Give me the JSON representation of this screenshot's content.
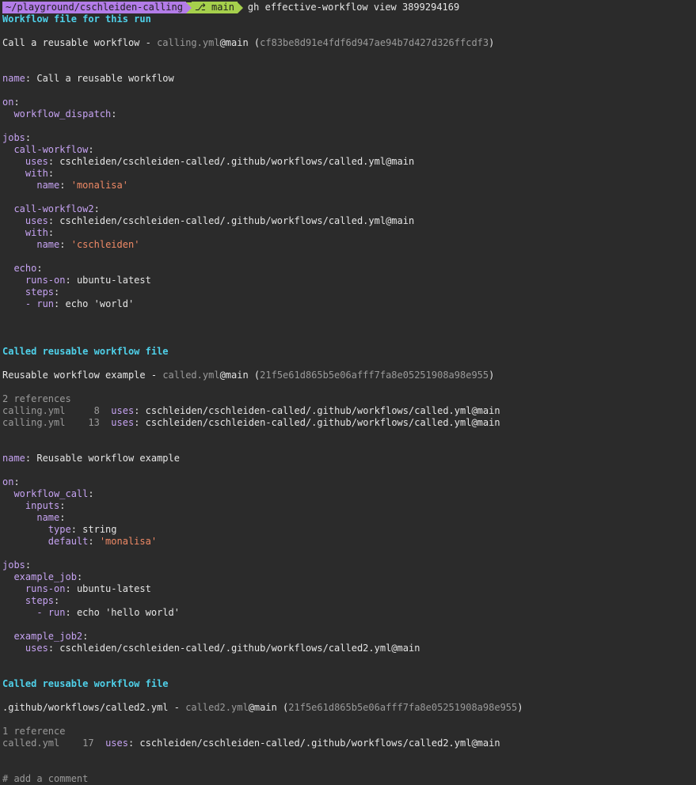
{
  "prompt": {
    "path": "~/playground/cschleiden-calling",
    "branch_icon": "git-branch-icon",
    "branch": " main",
    "command": "gh effective-workflow view 3899294169"
  },
  "colors": {
    "background": "#2b2b2b",
    "header": "#4fd1ea",
    "yaml_key": "#c6a3f2",
    "yaml_string": "#f08a66",
    "dim": "#9a9a9a",
    "prompt_path_bg": "#b37ce8",
    "prompt_branch_bg": "#a6d04c"
  },
  "sections": {
    "run": {
      "title": "Workflow file for this run",
      "file_name": "Call a reusable workflow",
      "sep": " - ",
      "file_ref": "calling.yml",
      "at": "@main",
      "sha": "cf83be8d91e4fdf6d947ae94b7d427d326ffcdf3",
      "yaml": {
        "name_key": "name",
        "name_val": "Call a reusable workflow",
        "on_key": "on",
        "wd_key": "workflow_dispatch",
        "jobs_key": "jobs",
        "job1_key": "call-workflow",
        "uses_key": "uses",
        "job1_uses": "cschleiden/cschleiden-called/.github/workflows/called.yml@main",
        "with_key": "with",
        "name_param": "name",
        "job1_name": "'monalisa'",
        "job2_key": "call-workflow2",
        "job2_uses": "cschleiden/cschleiden-called/.github/workflows/called.yml@main",
        "job2_name": "'cschleiden'",
        "job3_key": "echo",
        "runs_on_key": "runs-on",
        "runs_on_val": "ubuntu-latest",
        "steps_key": "steps",
        "run_key": "run",
        "run_val": "echo 'world'"
      }
    },
    "called1": {
      "title": "Called reusable workflow file",
      "file_name": "Reusable workflow example",
      "sep": " - ",
      "file_ref": "called.yml",
      "at": "@main",
      "sha": "21f5e61d865b5e06afff7fa8e05251908a98e955",
      "ref_count": "2 references",
      "refs": [
        {
          "file": "calling.yml",
          "line": "8",
          "uses_key": "uses",
          "target": "cschleiden/cschleiden-called/.github/workflows/called.yml@main"
        },
        {
          "file": "calling.yml",
          "line": "13",
          "uses_key": "uses",
          "target": "cschleiden/cschleiden-called/.github/workflows/called.yml@main"
        }
      ],
      "yaml": {
        "name_key": "name",
        "name_val": "Reusable workflow example",
        "on_key": "on",
        "wc_key": "workflow_call",
        "inputs_key": "inputs",
        "input_name_key": "name",
        "type_key": "type",
        "type_val": "string",
        "default_key": "default",
        "default_val": "'monalisa'",
        "jobs_key": "jobs",
        "job1_key": "example_job",
        "runs_on_key": "runs-on",
        "runs_on_val": "ubuntu-latest",
        "steps_key": "steps",
        "run_key": "run",
        "run_val": "echo 'hello world'",
        "job2_key": "example_job2",
        "uses_key": "uses",
        "job2_uses": "cschleiden/cschleiden-called/.github/workflows/called2.yml@main"
      }
    },
    "called2": {
      "title": "Called reusable workflow file",
      "file_name": ".github/workflows/called2.yml",
      "sep": " - ",
      "file_ref": "called2.yml",
      "at": "@main",
      "sha": "21f5e61d865b5e06afff7fa8e05251908a98e955",
      "ref_count": "1 reference",
      "refs": [
        {
          "file": "called.yml",
          "line": "17",
          "uses_key": "uses",
          "target": "cschleiden/cschleiden-called/.github/workflows/called2.yml@main"
        }
      ],
      "comment": "# add a comment"
    }
  }
}
